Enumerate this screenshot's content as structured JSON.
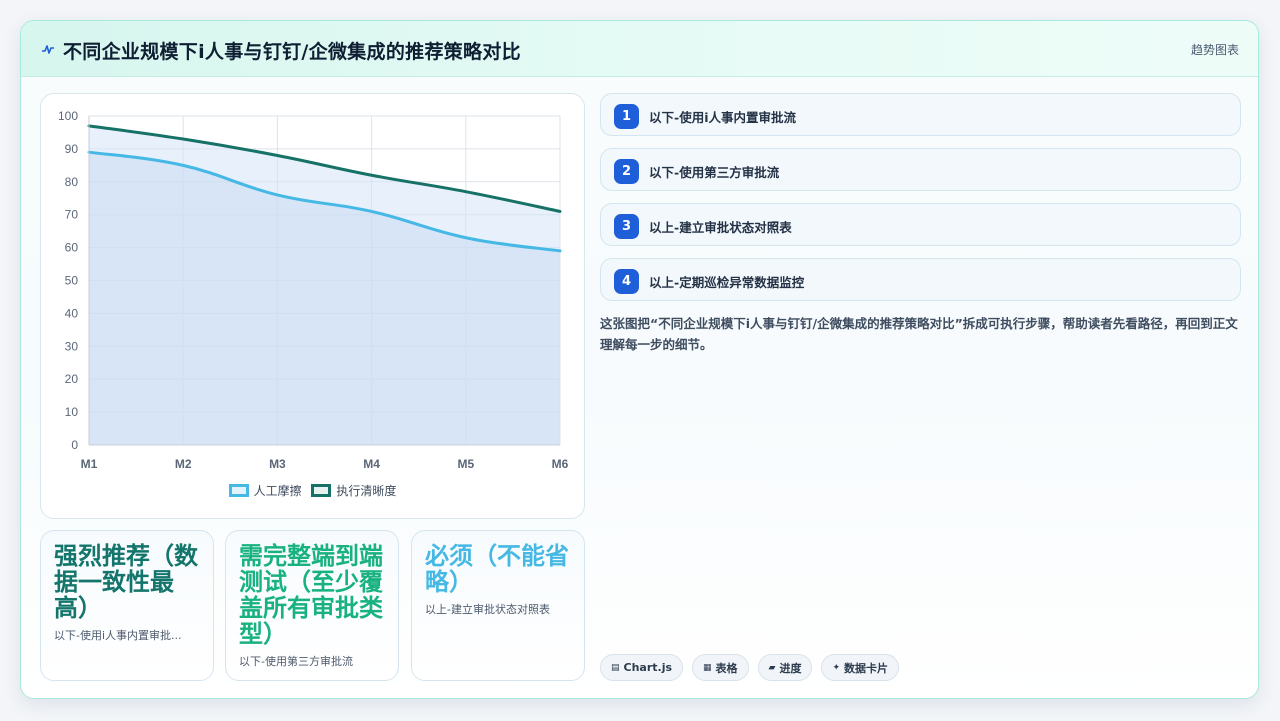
{
  "header": {
    "title": "不同企业规模下i人事与钉钉/企微集成的推荐策略对比",
    "tag": "趋势图表",
    "logo_icon": "pulse-icon"
  },
  "colors": {
    "series_a": "#45b8e6",
    "series_b": "#167166",
    "accent": "#1e5ed8",
    "kpi_1": "#13756b",
    "kpi_2": "#18b27f",
    "kpi_3": "#46b8e4"
  },
  "chart_data": {
    "type": "area",
    "categories": [
      "M1",
      "M2",
      "M3",
      "M4",
      "M5",
      "M6"
    ],
    "series": [
      {
        "name": "人工摩擦",
        "values": [
          89,
          85,
          76,
          71,
          63,
          59
        ]
      },
      {
        "name": "执行清晰度",
        "values": [
          97,
          93,
          88,
          82,
          77,
          71
        ]
      }
    ],
    "ylim": [
      0,
      100
    ],
    "yticks": [
      0,
      10,
      20,
      30,
      40,
      50,
      60,
      70,
      80,
      90,
      100
    ],
    "grid": true,
    "legend": "bottom"
  },
  "kpis": [
    {
      "value": "强烈推荐（数据一致性最高）",
      "label": "以下-使用i人事内置审批..."
    },
    {
      "value": "需完整端到端测试（至少覆盖所有审批类型）",
      "label": "以下-使用第三方审批流"
    },
    {
      "value": "必须（不能省略）",
      "label": "以上-建立审批状态对照表"
    }
  ],
  "steps": [
    {
      "num": "1",
      "label": "以下-使用i人事内置审批流"
    },
    {
      "num": "2",
      "label": "以下-使用第三方审批流"
    },
    {
      "num": "3",
      "label": "以上-建立审批状态对照表"
    },
    {
      "num": "4",
      "label": "以上-定期巡检异常数据监控"
    }
  ],
  "description": "这张图把“不同企业规模下i人事与钉钉/企微集成的推荐策略对比”拆成可执行步骤，帮助读者先看路径，再回到正文理解每一步的细节。",
  "chips": [
    {
      "icon": "chart-icon",
      "glyph": "▤",
      "label": "Chart.js"
    },
    {
      "icon": "table-icon",
      "glyph": "▦",
      "label": "表格"
    },
    {
      "icon": "progress-icon",
      "glyph": "▰",
      "label": "进度"
    },
    {
      "icon": "sparkle-icon",
      "glyph": "✦",
      "label": "数据卡片"
    }
  ]
}
